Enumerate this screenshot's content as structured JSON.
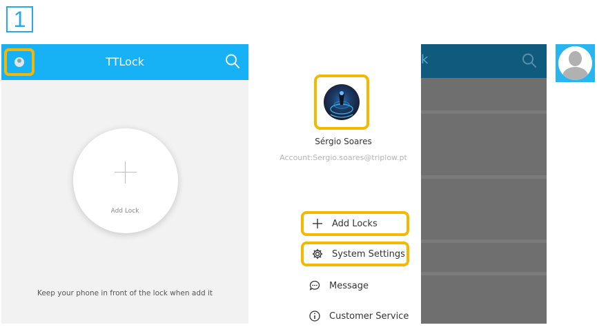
{
  "step": {
    "number": "1"
  },
  "colors": {
    "topbar": "#17b2f5",
    "highlight": "#f4b800",
    "dim_overlay": "#6f6f6f",
    "badge": "#29a8e8"
  },
  "main_screen": {
    "title": "TTLock",
    "add_lock_label": "Add Lock",
    "hint": "Keep your phone in front of the lock when add it",
    "icons": {
      "left": "user-avatar-icon",
      "right": "search-icon",
      "center": "plus-icon"
    }
  },
  "drawer": {
    "user_name": "Sérgio Soares",
    "account": "Account:Sergio.soares@triplow.pt",
    "menu": [
      {
        "label": "Add Locks",
        "icon": "plus-icon",
        "highlighted": true
      },
      {
        "label": "System Settings",
        "icon": "gear-icon",
        "highlighted": true
      },
      {
        "label": "Message",
        "icon": "chat-bubble-icon",
        "highlighted": false
      },
      {
        "label": "Customer Service",
        "icon": "info-icon",
        "highlighted": false
      }
    ]
  },
  "background_screen": {
    "title_fragment": "k"
  }
}
